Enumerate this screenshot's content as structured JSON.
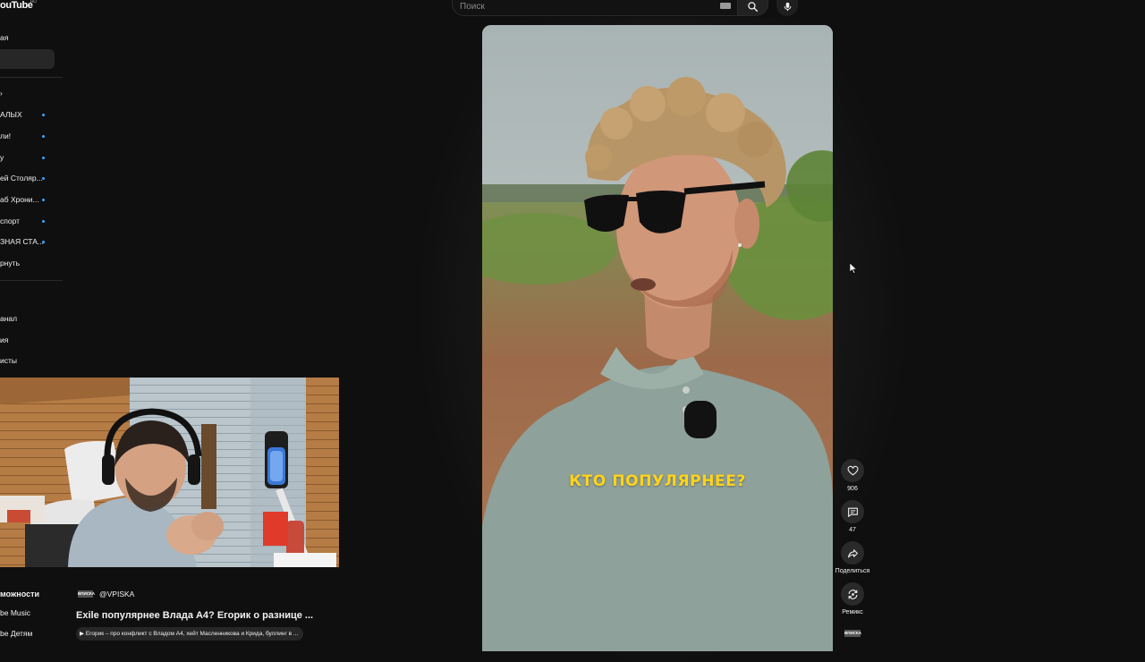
{
  "header": {
    "logo_text": "ouTube",
    "logo_sup": "RU",
    "search_placeholder": "Поиск"
  },
  "sidebar": {
    "top_items": [
      {
        "label": "ая"
      },
      {
        "label": ""
      }
    ],
    "expander_label": "›",
    "subscriptions": [
      {
        "label": "АЛЫХ",
        "has_new": true
      },
      {
        "label": "ли!",
        "has_new": true
      },
      {
        "label": "у",
        "has_new": true
      },
      {
        "label": "ей Столяр...",
        "has_new": true
      },
      {
        "label": "аб Хрони...",
        "has_new": true
      },
      {
        "label": "спорт",
        "has_new": true
      },
      {
        "label": "ЗНАЯ СТА...",
        "has_new": true
      }
    ],
    "collapse_label": "рнуть",
    "you_items": [
      {
        "label": "анал"
      },
      {
        "label": "ия"
      },
      {
        "label": "исты"
      }
    ],
    "more_section_title": "можности",
    "more_items": [
      {
        "label": "be Music"
      },
      {
        "label": "be Детям"
      }
    ]
  },
  "short": {
    "caption": "КТО ПОПУЛЯРНЕЕ?",
    "channel_logo_text": "ВПИСКА",
    "channel_handle": "@VPISKA",
    "title": "Exile популярнее Влада А4? Егорик о разнице ...",
    "suggestion": "Егорик – про конфликт с Владом А4, хейт Масленникова и Крида, буллинг в ..."
  },
  "actions": {
    "likes": "906",
    "comments": "47",
    "share_label": "Поделиться",
    "remix_label": "Ремикс"
  },
  "colors": {
    "background": "#0f0f0f",
    "caption_yellow": "#ffd31a",
    "new_dot": "#3ea6ff"
  }
}
